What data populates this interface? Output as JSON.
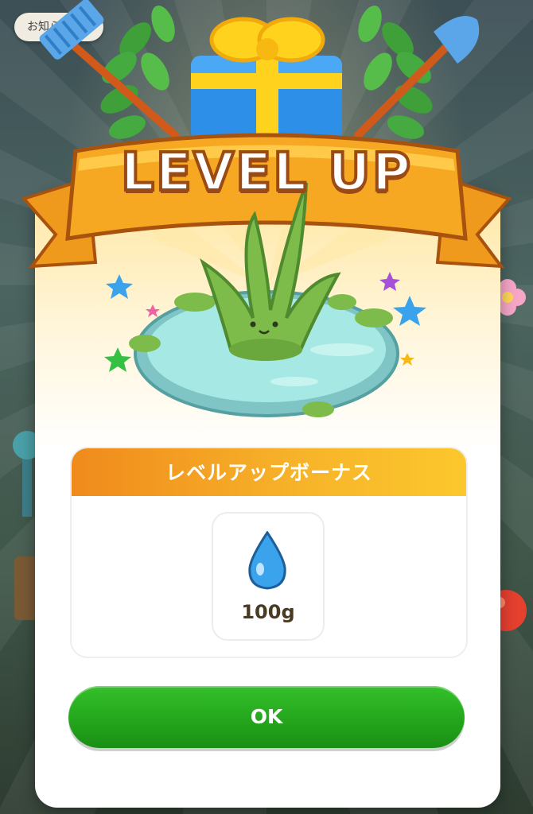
{
  "notice_label": "お知らせ",
  "banner": {
    "title": "LEVEL UP"
  },
  "bonus": {
    "heading": "レベルアップボーナス",
    "reward": {
      "icon": "water-drop-icon",
      "amount": "100g"
    }
  },
  "ok_button": {
    "label": "OK"
  },
  "colors": {
    "ribbon": "#f7a823",
    "ribbon_dark": "#c9660f",
    "header_gradient_start": "#f08a1c",
    "header_gradient_end": "#fcc72d",
    "ok_green": "#22a41b",
    "gift_blue": "#2e8fe8",
    "gift_ribbon": "#ffd21e",
    "pond": "#9fe3e0",
    "plant_green": "#7dbb4a"
  }
}
